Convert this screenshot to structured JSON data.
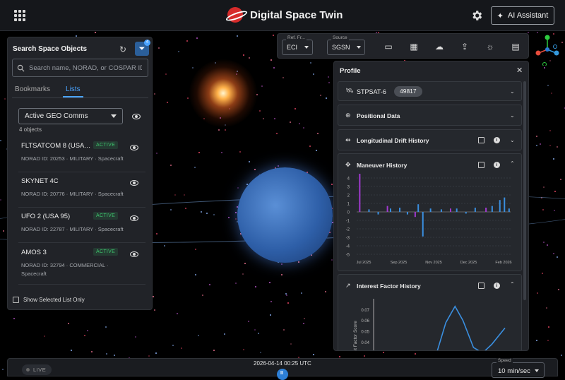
{
  "app": {
    "title": "Digital Space Twin",
    "ai_button": "AI Assistant"
  },
  "search_panel": {
    "title": "Search Space Objects",
    "search_placeholder": "Search name, NORAD, or COSPAR ID",
    "tabs": [
      "Bookmarks",
      "Lists"
    ],
    "active_tab": "Lists",
    "selected_list": "Active GEO Comms",
    "count": "4 objects",
    "objects": [
      {
        "name": "FLTSATCOM 8 (USA 4...",
        "status": "ACTIVE",
        "meta": "NORAD ID: 20253 · MILITARY · Spacecraft"
      },
      {
        "name": "SKYNET 4C",
        "status": "ACTIVE",
        "meta": "NORAD ID: 20776 · MILITARY · Spacecraft"
      },
      {
        "name": "UFO 2 (USA 95)",
        "status": "ACTIVE",
        "meta": "NORAD ID: 22787 · MILITARY · Spacecraft"
      },
      {
        "name": "AMOS 3",
        "status": "ACTIVE",
        "meta": "NORAD ID: 32794 · COMMERCIAL · Spacecraft"
      }
    ],
    "show_selected": "Show Selected List Only",
    "filter_badge": "4"
  },
  "toolbar": {
    "ref_frame_label": "Ref. Fr...",
    "ref_frame_value": "ECI",
    "source_label": "Source",
    "source_value": "SGSN"
  },
  "profile": {
    "title": "Profile",
    "satellite_name": "STPSAT-6",
    "norad": "49817",
    "sections": {
      "positional": "Positional Data",
      "drift": "Longitudinal Drift History",
      "maneuver": "Maneuver History",
      "interest": "Interest Factor History"
    }
  },
  "maneuver_chart": {
    "y_ticks": [
      "4",
      "3",
      "2",
      "1",
      "0",
      "-1",
      "-2",
      "-3",
      "-4",
      "-5"
    ],
    "x_ticks": [
      "Jul 2025",
      "Sep 2025",
      "Nov 2025",
      "Dec 2025",
      "Feb 2026"
    ]
  },
  "interest_chart": {
    "y_ticks": [
      "0.07",
      "0.06",
      "0.05",
      "0.04",
      "0.03"
    ],
    "ylabel": "rest Factor Score"
  },
  "chart_data": [
    {
      "type": "bar",
      "series": [
        {
          "color": "#a23ad1",
          "x": [
            0.02,
            0.2,
            0.38,
            0.61,
            0.84
          ],
          "values": [
            4.6,
            0.7,
            -0.6,
            0.4,
            0.5
          ]
        },
        {
          "color": "#3a8fe0",
          "x": [
            0.08,
            0.14,
            0.22,
            0.28,
            0.33,
            0.4,
            0.43,
            0.48,
            0.55,
            0.65,
            0.71,
            0.77,
            0.88,
            0.93,
            0.96,
            0.99
          ],
          "values": [
            0.3,
            -0.3,
            0.4,
            0.5,
            -0.3,
            0.9,
            -2.9,
            0.4,
            0.3,
            0.4,
            -0.2,
            0.5,
            0.7,
            1.4,
            1.7,
            0.4
          ]
        }
      ],
      "ylim": [
        -5,
        4
      ]
    },
    {
      "type": "line",
      "series": [
        {
          "color": "#3a8fe0",
          "x": [
            0,
            0.35,
            0.48,
            0.55,
            0.62,
            0.68,
            0.76,
            0.83,
            0.9,
            1.0
          ],
          "values": [
            0.02,
            0.02,
            0.03,
            0.058,
            0.073,
            0.06,
            0.035,
            0.03,
            0.038,
            0.053
          ]
        }
      ],
      "ylim": [
        0.02,
        0.08
      ]
    }
  ],
  "timeline": {
    "live": "LIVE",
    "datetime": "2026-04-14 00:25 UTC",
    "speed_label": "Speed",
    "speed_value": "10 min/sec"
  }
}
